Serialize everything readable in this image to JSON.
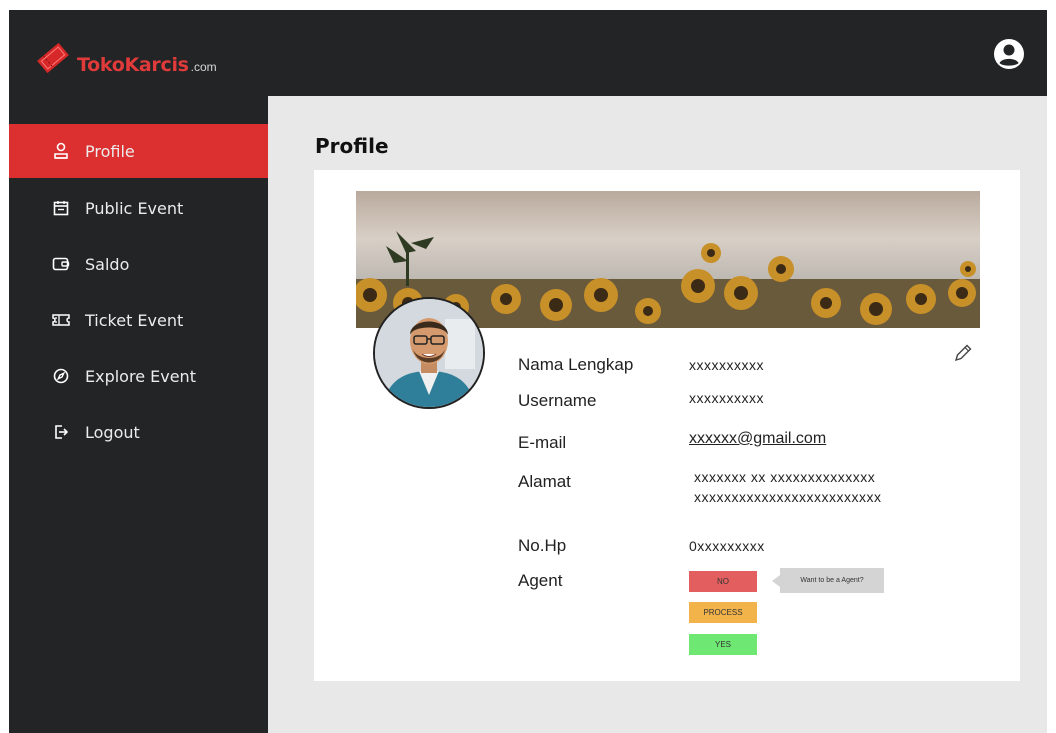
{
  "app": {
    "logo_text": "TokoKarcis",
    "logo_suffix": ".com"
  },
  "header": {
    "user_icon": "user-circle-icon"
  },
  "sidebar": {
    "items": [
      {
        "label": "Profile",
        "icon": "profile-icon",
        "active": true
      },
      {
        "label": "Public Event",
        "icon": "calendar-icon",
        "active": false
      },
      {
        "label": "Saldo",
        "icon": "wallet-icon",
        "active": false
      },
      {
        "label": "Ticket Event",
        "icon": "ticket-icon",
        "active": false
      },
      {
        "label": "Explore Event",
        "icon": "compass-icon",
        "active": false
      },
      {
        "label": "Logout",
        "icon": "logout-icon",
        "active": false
      }
    ]
  },
  "main": {
    "title": "Profile"
  },
  "profile": {
    "fields": {
      "nama_label": "Nama Lengkap",
      "nama_value": "xxxxxxxxxx",
      "username_label": "Username",
      "username_value": "xxxxxxxxxx",
      "email_label": "E-mail",
      "email_value": "xxxxxx@gmail.com",
      "alamat_label": "Alamat",
      "alamat_line1": "xxxxxxx xx xxxxxxxxxxxxxx",
      "alamat_line2": "xxxxxxxxxxxxxxxxxxxxxxxxx",
      "nohp_label": "No.Hp",
      "nohp_value": "0xxxxxxxxx",
      "agent_label": "Agent"
    },
    "agent_status": {
      "no": "NO",
      "process": "PROCESS",
      "yes": "YES",
      "tooltip": "Want to be a Agent?"
    }
  },
  "colors": {
    "accent": "#dc3030",
    "dark": "#232425",
    "no": "#e35f5f",
    "process": "#f2b34a",
    "yes": "#6ee873"
  }
}
